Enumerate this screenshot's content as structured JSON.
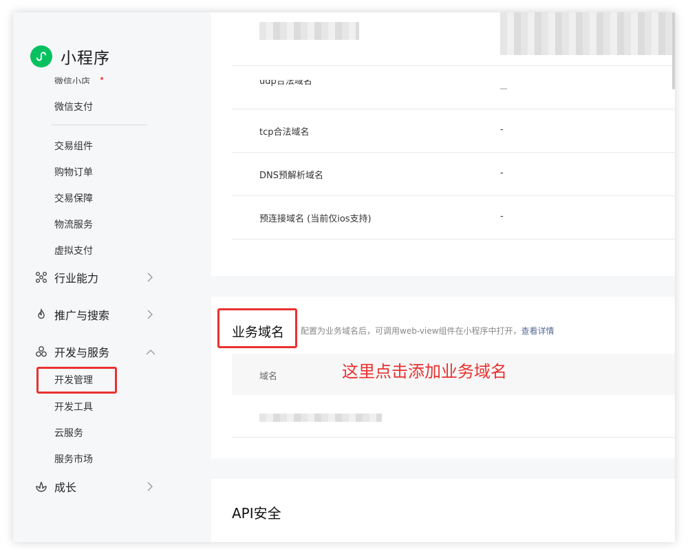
{
  "brand": {
    "title": "小程序",
    "icon": "miniprogram-logo-icon"
  },
  "sidebar": {
    "clipped_item": "微信小店",
    "items_top": [
      "微信支付"
    ],
    "items_trade": [
      "交易组件",
      "购物订单",
      "交易保障",
      "物流服务",
      "虚拟支付"
    ],
    "groups": [
      {
        "label": "行业能力",
        "icon": "industry-icon",
        "state": "collapsed"
      },
      {
        "label": "推广与搜索",
        "icon": "promotion-icon",
        "state": "collapsed"
      },
      {
        "label": "开发与服务",
        "icon": "dev-service-icon",
        "state": "expanded"
      }
    ],
    "dev_items": [
      "开发管理",
      "开发工具",
      "云服务",
      "服务市场"
    ],
    "growth": {
      "label": "成长",
      "icon": "growth-icon",
      "state": "collapsed"
    }
  },
  "server_domains": {
    "partial_label": "udp合法域名",
    "partial_value": "-",
    "rows": [
      {
        "label": "tcp合法域名",
        "value": "-"
      },
      {
        "label": "DNS预解析域名",
        "value": "-"
      },
      {
        "label": "预连接域名 (当前仅ios支持)",
        "value": "-"
      }
    ]
  },
  "business_domain": {
    "title": "业务域名",
    "description": "配置为业务域名后，可调用web-view组件在小程序中打开，",
    "link": "查看详情",
    "column_header": "域名",
    "annotation": "这里点击添加业务域名"
  },
  "api_security": {
    "title": "API安全"
  },
  "colors": {
    "accent": "#07c160",
    "highlight": "#e8312f",
    "link": "#576b95"
  }
}
